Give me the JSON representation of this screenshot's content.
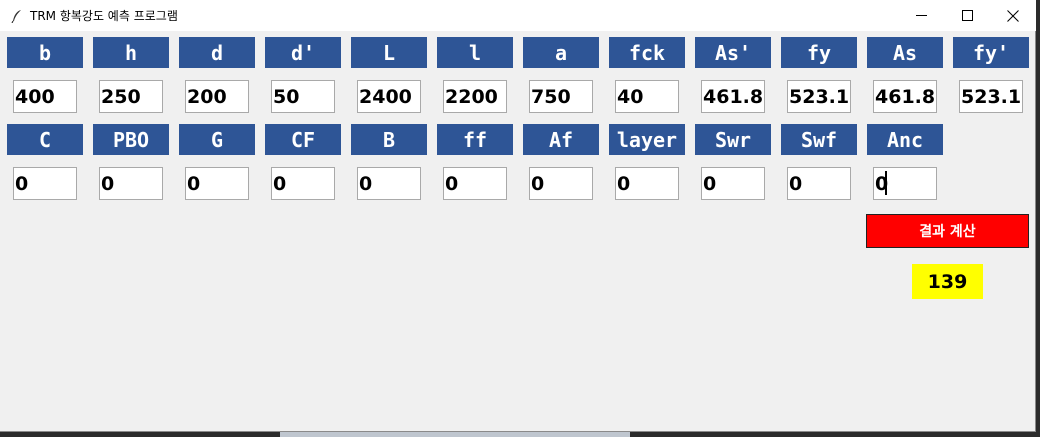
{
  "window": {
    "title": "TRM 항복강도 예측 프로그램"
  },
  "row1": {
    "labels": [
      "b",
      "h",
      "d",
      "d'",
      "L",
      "l",
      "a",
      "fck",
      "As'",
      "fy",
      "As",
      "fy'"
    ],
    "values": [
      "400",
      "250",
      "200",
      "50",
      "2400",
      "2200",
      "750",
      "40",
      "461.8",
      "523.15",
      "461.8",
      "523.15"
    ]
  },
  "row2": {
    "labels": [
      "C",
      "PBO",
      "G",
      "CF",
      "B",
      "ff",
      "Af",
      "layer",
      "Swr",
      "Swf",
      "Anc"
    ],
    "values": [
      "0",
      "0",
      "0",
      "0",
      "0",
      "0",
      "0",
      "0",
      "0",
      "0",
      "0"
    ]
  },
  "actions": {
    "calculate_label": "결과 계산"
  },
  "result": {
    "value": "139"
  },
  "colors": {
    "label_bg": "#2e5596",
    "button_bg": "#ff0000",
    "result_bg": "#ffff00",
    "window_bg": "#f0f0f0"
  },
  "icons": {
    "app": "feather-icon",
    "minimize": "minimize-icon",
    "maximize": "maximize-icon",
    "close": "close-icon"
  }
}
